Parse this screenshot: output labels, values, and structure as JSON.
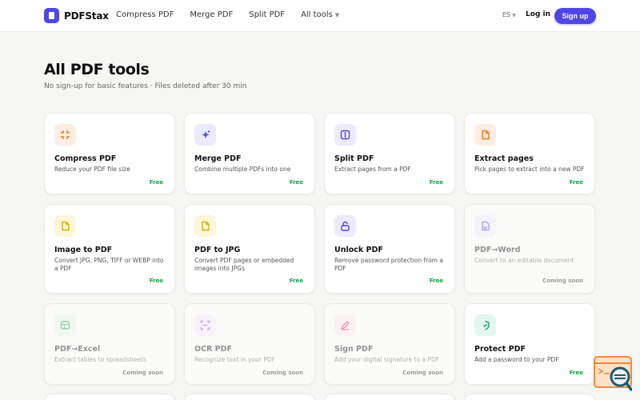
{
  "header": {
    "brand": "PDFStax",
    "nav": [
      "Compress PDF",
      "Merge PDF",
      "Split PDF"
    ],
    "all_tools": "All tools",
    "language": "ES",
    "login": "Log in",
    "signup": "Sign up"
  },
  "hero": {
    "title": "All PDF tools",
    "subtitle": "No sign-up for basic features · Files deleted after 30 min"
  },
  "cards": [
    {
      "title": "Compress PDF",
      "desc": "Reduce your PDF file size",
      "badge": "Free",
      "icon": "compress-icon",
      "color": "#f97316",
      "bg": "#fdeee4"
    },
    {
      "title": "Merge PDF",
      "desc": "Combine multiple PDFs into one",
      "badge": "Free",
      "icon": "sparkle-icon",
      "color": "#4f46e5",
      "bg": "#eceafd"
    },
    {
      "title": "Split PDF",
      "desc": "Extract pages from a PDF",
      "badge": "Free",
      "icon": "split-icon",
      "color": "#4f46e5",
      "bg": "#eceafd"
    },
    {
      "title": "Extract pages",
      "desc": "Pick pages to extract into a new PDF",
      "badge": "Free",
      "icon": "file-icon",
      "color": "#f97316",
      "bg": "#fdeee4"
    },
    {
      "title": "Image to PDF",
      "desc": "Convert JPG, PNG, TIFF or WEBP into a PDF",
      "badge": "Free",
      "icon": "file-icon",
      "color": "#d4b106",
      "bg": "#fdf6d8"
    },
    {
      "title": "PDF to JPG",
      "desc": "Convert PDF pages or embedded images into JPGs",
      "badge": "Free",
      "icon": "file-icon",
      "color": "#d4b106",
      "bg": "#fdf6d8"
    },
    {
      "title": "Unlock PDF",
      "desc": "Remove password protection from a PDF",
      "badge": "Free",
      "icon": "unlock-icon",
      "color": "#4f46e5",
      "bg": "#eceafd"
    },
    {
      "title": "PDF→Word",
      "desc": "Convert to an editable document",
      "badge": "Coming soon",
      "icon": "word-icon",
      "color": "#4f46e5",
      "bg": "#eceafd"
    },
    {
      "title": "PDF→Excel",
      "desc": "Extract tables to spreadsheets",
      "badge": "Coming soon",
      "icon": "table-icon",
      "color": "#16a34a",
      "bg": "#e5f6ea"
    },
    {
      "title": "OCR PDF",
      "desc": "Recognize text in your PDF",
      "badge": "Coming soon",
      "icon": "scan-icon",
      "color": "#9333ea",
      "bg": "#f3e8fd"
    },
    {
      "title": "Sign PDF",
      "desc": "Add your digital signature to a PDF",
      "badge": "Coming soon",
      "icon": "pen-icon",
      "color": "#e11d48",
      "bg": "#fde6ea"
    },
    {
      "title": "Protect PDF",
      "desc": "Add a password to your PDF",
      "badge": "Free",
      "icon": "shield-icon",
      "color": "#0f9d76",
      "bg": "#e3f6ef"
    }
  ]
}
